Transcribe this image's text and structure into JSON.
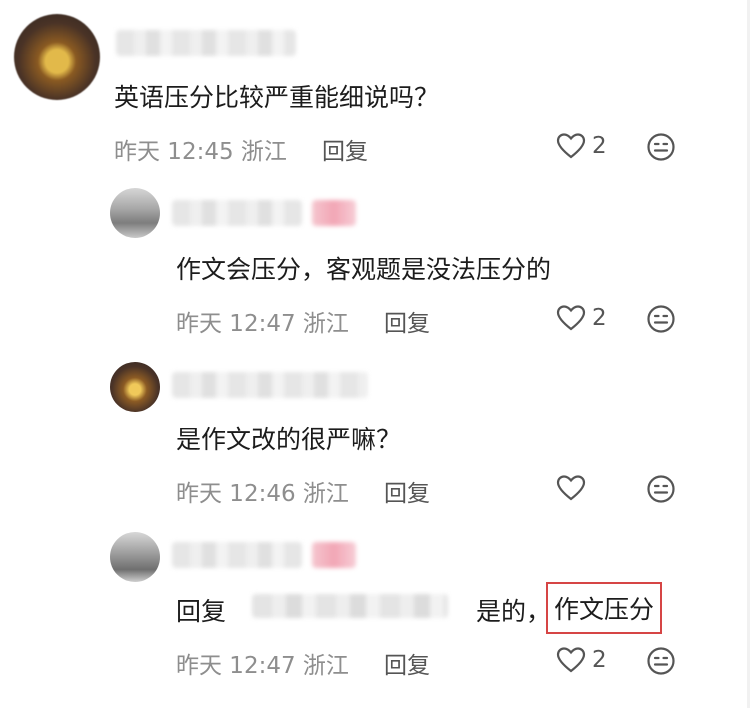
{
  "comments": [
    {
      "text": "英语压分比较严重能细说吗？",
      "time": "昨天 12:45 浙江",
      "reply_label": "回复",
      "likes": "2"
    },
    {
      "text": "作文会压分，客观题是没法压分的",
      "time": "昨天 12:47 浙江",
      "reply_label": "回复",
      "likes": "2"
    },
    {
      "text": "是作文改的很严嘛？",
      "time": "昨天 12:46 浙江",
      "reply_label": "回复",
      "likes": ""
    },
    {
      "reply_prefix": "回复",
      "text_main": "是的，",
      "text_highlight": "作文压分",
      "time": "昨天 12:47 浙江",
      "reply_label": "回复",
      "likes": "2"
    }
  ],
  "colors": {
    "highlight_border": "#d64545",
    "meta_text": "#8e8e8e"
  },
  "icons": [
    "heart-outline-icon",
    "emoji-face-icon"
  ]
}
